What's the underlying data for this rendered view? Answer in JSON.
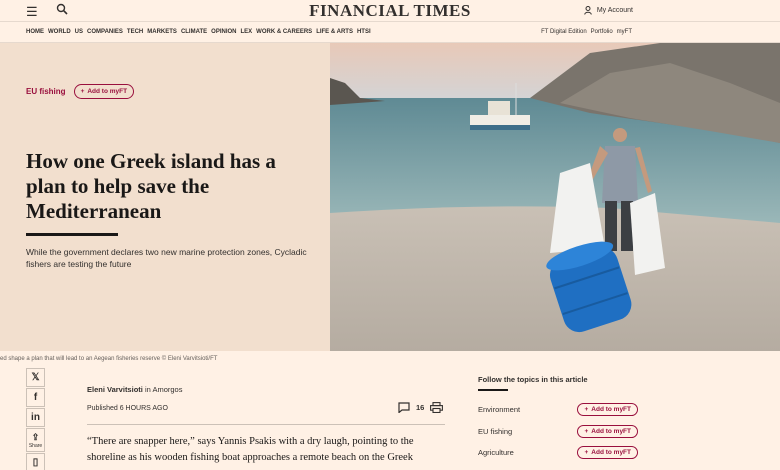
{
  "header": {
    "menu_icon": "hamburger-icon",
    "search_icon": "search-icon",
    "masthead": "FINANCIAL TIMES",
    "account_label": "My Account",
    "account_icon": "user-icon"
  },
  "nav": {
    "items": [
      "HOME",
      "WORLD",
      "US",
      "COMPANIES",
      "TECH",
      "MARKETS",
      "CLIMATE",
      "OPINION",
      "LEX",
      "WORK & CAREERS",
      "LIFE & ARTS",
      "HTSI"
    ],
    "right": [
      "FT Digital Edition",
      "Portfolio",
      "myFT"
    ]
  },
  "article": {
    "topic": "EU fishing",
    "add_label": "Add to myFT",
    "headline": "How one Greek island has a plan to help save the Mediterranean",
    "standfirst": "While the government declares two new marine protection zones, Cycladic fishers are testing the future",
    "caption": "ed shape a plan that will lead to an Aegean fisheries reserve © Eleni Varvitsioti/FT",
    "author": "Eleni Varvitsioti",
    "location_prefix": "in",
    "location": "Amorgos",
    "published_label": "Published",
    "published_time": "6 HOURS AGO",
    "comment_count": "16",
    "body": "“There are snapper here,” says Yannis Psakis with a dry laugh, pointing to the shoreline as his wooden fishing boat approaches a remote beach on the Greek"
  },
  "share": {
    "share_label": "Share",
    "icons": [
      "x-icon",
      "facebook-icon",
      "linkedin-icon",
      "share-icon",
      "save-icon"
    ]
  },
  "follow": {
    "title": "Follow the topics in this article",
    "topics": [
      "Environment",
      "EU fishing",
      "Agriculture"
    ],
    "add_label": "Add to myFT"
  },
  "colors": {
    "background": "#fff1e5",
    "hero_panel": "#f2dfce",
    "accent": "#990f3d",
    "text": "#33302e"
  }
}
